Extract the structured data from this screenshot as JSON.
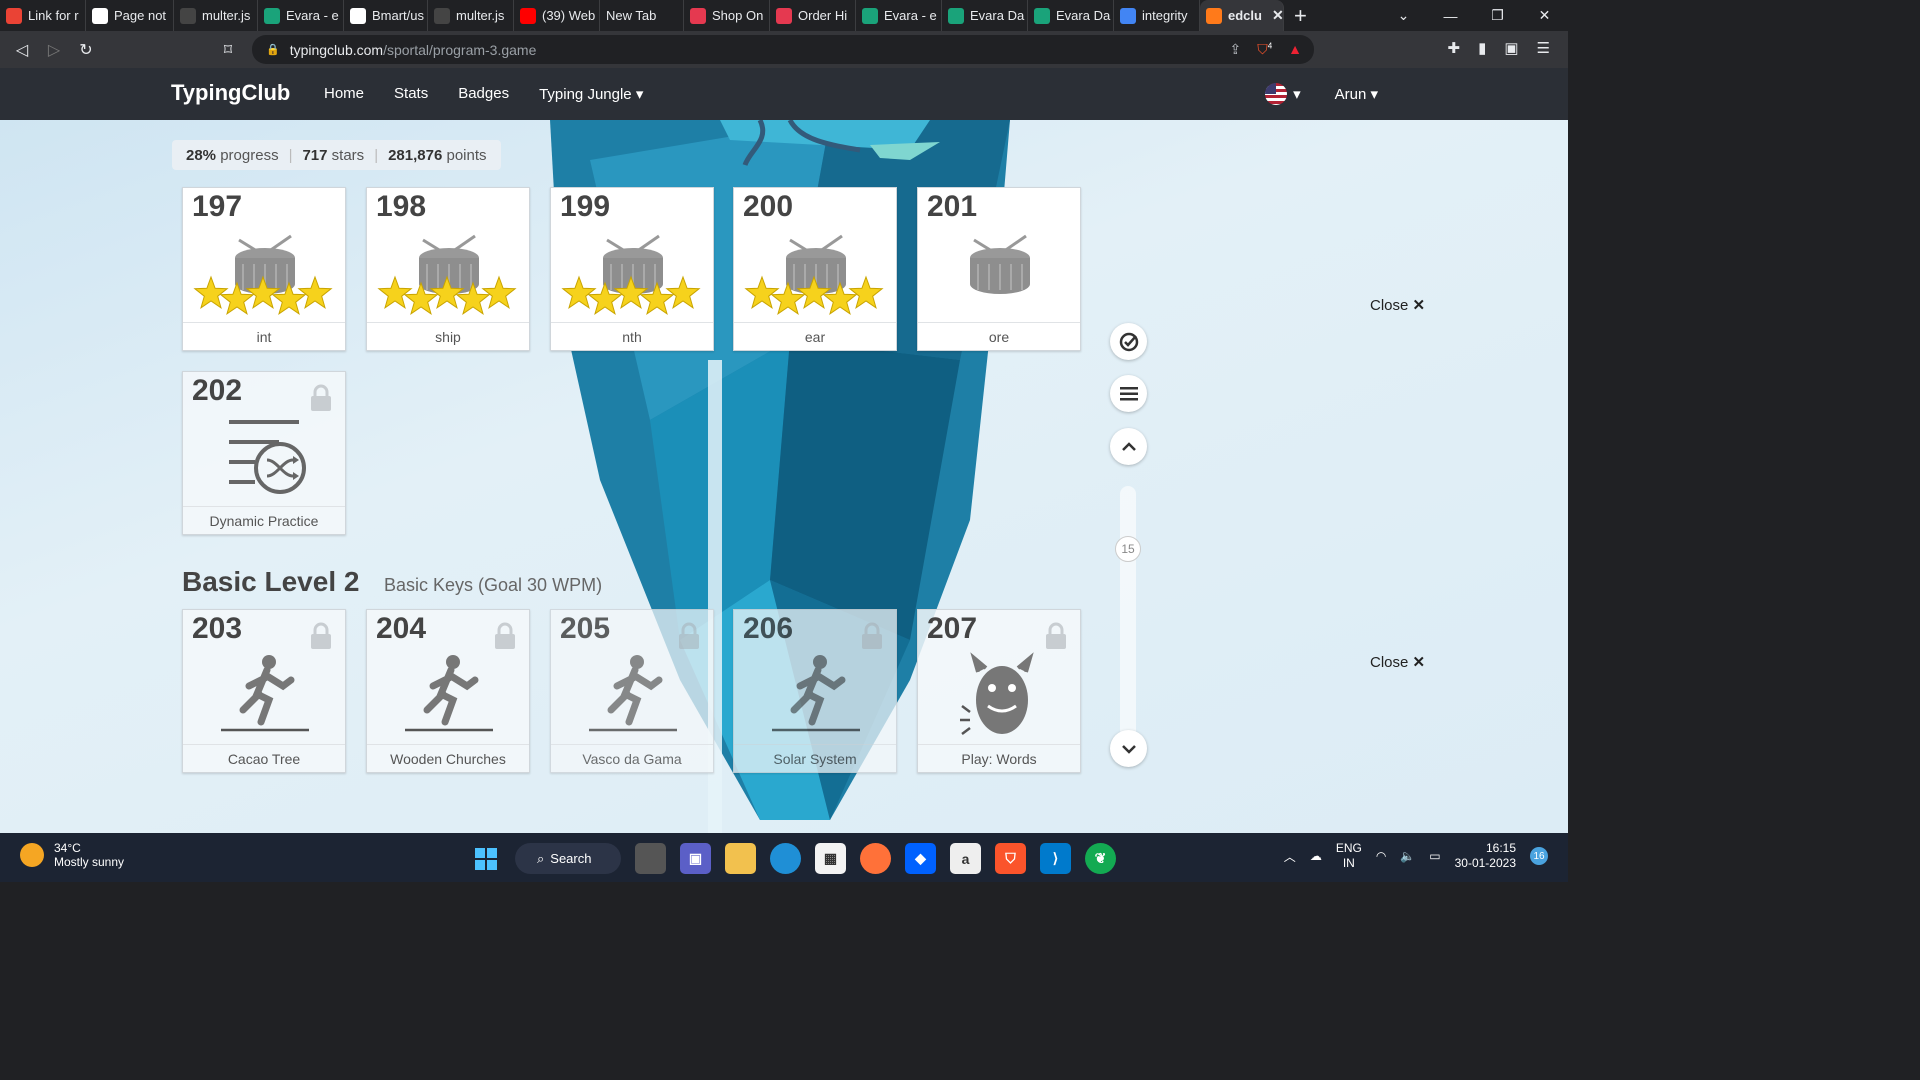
{
  "browser": {
    "tabs": [
      {
        "label": "Link for r",
        "icon": "gmail-icon",
        "color": "#ea4335"
      },
      {
        "label": "Page not",
        "icon": "github-icon",
        "color": "#ffffff"
      },
      {
        "label": "multer.js",
        "icon": "github-icon",
        "color": "#444444"
      },
      {
        "label": "Evara - e",
        "icon": "evara-icon",
        "color": "#1aa37a"
      },
      {
        "label": "Bmart/us",
        "icon": "github-icon",
        "color": "#ffffff"
      },
      {
        "label": "multer.js",
        "icon": "github-icon",
        "color": "#444444"
      },
      {
        "label": "(39) Web",
        "icon": "youtube-icon",
        "color": "#ff0000"
      },
      {
        "label": "New Tab",
        "icon": "",
        "color": ""
      },
      {
        "label": "Shop On",
        "icon": "shop-icon",
        "color": "#e53950"
      },
      {
        "label": "Order Hi",
        "icon": "shop-icon",
        "color": "#e53950"
      },
      {
        "label": "Evara - e",
        "icon": "evara-icon",
        "color": "#1aa37a"
      },
      {
        "label": "Evara Da",
        "icon": "evara-icon",
        "color": "#1aa37a"
      },
      {
        "label": "Evara Da",
        "icon": "evara-icon",
        "color": "#1aa37a"
      },
      {
        "label": "integrity",
        "icon": "google-icon",
        "color": "#4285f4"
      },
      {
        "label": "edclu",
        "icon": "flame-icon",
        "color": "#ff7a1a",
        "active": true
      }
    ],
    "url_host": "typingclub.com",
    "url_path": "/sportal/program-3.game",
    "brave_badge": "4"
  },
  "site": {
    "brand": "TypingClub",
    "nav": [
      "Home",
      "Stats",
      "Badges",
      "Typing Jungle"
    ],
    "user": "Arun",
    "caret": "▾"
  },
  "progress": {
    "percent": "28%",
    "percent_label": "progress",
    "stars": "717",
    "stars_label": "stars",
    "points": "281,876",
    "points_label": "points"
  },
  "lessons_row1": [
    {
      "num": "197",
      "label": "int",
      "stars": 5,
      "locked": false
    },
    {
      "num": "198",
      "label": "ship",
      "stars": 5,
      "locked": false
    },
    {
      "num": "199",
      "label": "nth",
      "stars": 5,
      "locked": false
    },
    {
      "num": "200",
      "label": "ear",
      "stars": 5,
      "locked": false
    },
    {
      "num": "201",
      "label": "ore",
      "stars": 0,
      "locked": false
    }
  ],
  "dynamic": {
    "num": "202",
    "label": "Dynamic Practice",
    "locked": true
  },
  "section": {
    "title": "Basic Level 2",
    "subtitle": "Basic Keys (Goal 30 WPM)"
  },
  "lessons_row2": [
    {
      "num": "203",
      "label": "Cacao Tree",
      "locked": true
    },
    {
      "num": "204",
      "label": "Wooden Churches",
      "locked": true
    },
    {
      "num": "205",
      "label": "Vasco da Gama",
      "locked": true
    },
    {
      "num": "206",
      "label": "Solar System",
      "locked": true
    },
    {
      "num": "207",
      "label": "Play: Words",
      "locked": true
    }
  ],
  "close_label": "Close",
  "scroll_value": "15",
  "taskbar": {
    "temp": "34°C",
    "weather": "Mostly sunny",
    "search": "Search",
    "lang1": "ENG",
    "lang2": "IN",
    "time": "16:15",
    "date": "30-01-2023",
    "notif": "16"
  }
}
